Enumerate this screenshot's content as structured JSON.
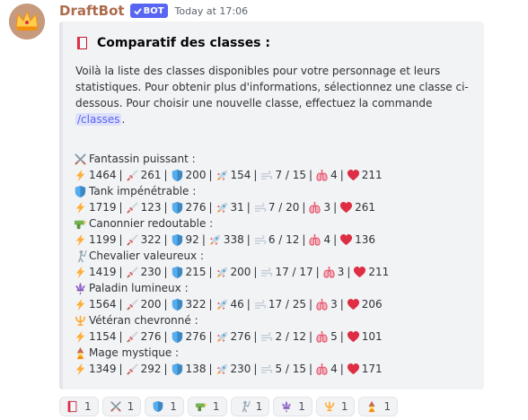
{
  "message": {
    "username": "DraftBot",
    "bot_tag": "BOT",
    "timestamp": "Today at 17:06"
  },
  "embed": {
    "title": "Comparatif des classes :",
    "desc_1": "Voilà la liste des classes disponibles pour votre personnage et leurs statistiques. Pour obtenir plus d'informations, sélectionnez une classe ci-dessous. Pour choisir une nouvelle classe, effectuez la commande ",
    "command": "/classes",
    "desc_2": ".",
    "classes": [
      {
        "icon": "crossed-swords-icon",
        "name": "Fantassin puissant :",
        "atk": "1464",
        "def": "261",
        "shield": "200",
        "speed": "154",
        "breath": "7 / 15",
        "lungs": "4",
        "hp": "211"
      },
      {
        "icon": "shield-icon",
        "name": "Tank impénétrable :",
        "atk": "1719",
        "def": "123",
        "shield": "276",
        "speed": "31",
        "breath": "7 / 20",
        "lungs": "3",
        "hp": "261"
      },
      {
        "icon": "water-gun-icon",
        "name": "Canonnier redoutable :",
        "atk": "1199",
        "def": "322",
        "shield": "92",
        "speed": "338",
        "breath": "6 / 12",
        "lungs": "4",
        "hp": "136"
      },
      {
        "icon": "fencer-icon",
        "name": "Chevalier valeureux :",
        "atk": "1419",
        "def": "230",
        "shield": "215",
        "speed": "200",
        "breath": "17 / 17",
        "lungs": "3",
        "hp": "211"
      },
      {
        "icon": "fleur-de-lis-icon",
        "name": "Paladin lumineux :",
        "atk": "1564",
        "def": "200",
        "shield": "322",
        "speed": "46",
        "breath": "17 / 25",
        "lungs": "3",
        "hp": "206"
      },
      {
        "icon": "trident-icon",
        "name": "Vétéran chevronné :",
        "atk": "1154",
        "def": "276",
        "shield": "276",
        "speed": "276",
        "breath": "2 / 12",
        "lungs": "5",
        "hp": "101"
      },
      {
        "icon": "mage-icon",
        "name": "Mage mystique :",
        "atk": "1349",
        "def": "292",
        "shield": "138",
        "speed": "230",
        "breath": "5 / 15",
        "lungs": "4",
        "hp": "171"
      }
    ]
  },
  "reactions": [
    {
      "icon": "book-icon",
      "count": "1"
    },
    {
      "icon": "crossed-swords-icon",
      "count": "1"
    },
    {
      "icon": "shield-icon",
      "count": "1"
    },
    {
      "icon": "water-gun-icon",
      "count": "1"
    },
    {
      "icon": "fencer-icon",
      "count": "1"
    },
    {
      "icon": "fleur-de-lis-icon",
      "count": "1"
    },
    {
      "icon": "trident-icon",
      "count": "1"
    },
    {
      "icon": "mage-icon",
      "count": "1"
    }
  ],
  "colors": {
    "username": "#ad6a4d",
    "bot_tag": "#5865f2",
    "embed_bg": "#f2f3f5",
    "hp_heart": "#dd2e44",
    "lightning": "#ffac33"
  }
}
